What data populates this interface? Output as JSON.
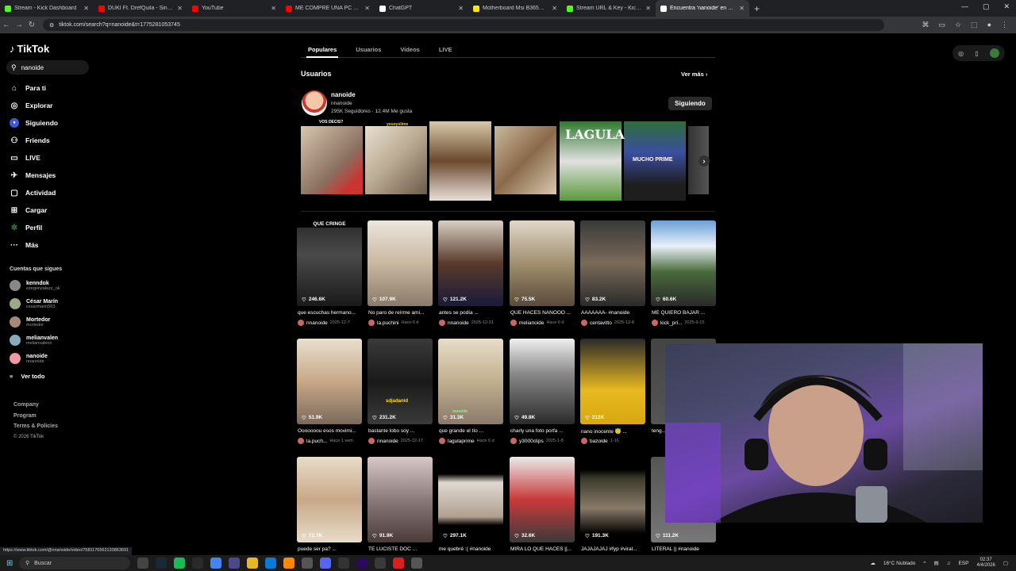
{
  "browser": {
    "tabs": [
      {
        "title": "Stream - Kick Dashboard",
        "color": "#53fc18"
      },
      {
        "title": "DUKI Ft. DrefQuila - Sin Culpa",
        "color": "#ff0000"
      },
      {
        "title": "YouTube",
        "color": "#ff0000"
      },
      {
        "title": "ME COMPRE UNA PC GAMER",
        "color": "#ff0000"
      },
      {
        "title": "ChatGPT",
        "color": "#ffffff"
      },
      {
        "title": "Motherboard Msi B365m Pro-V",
        "color": "#ffe600"
      },
      {
        "title": "Stream URL & Key - Kick Dashb",
        "color": "#53fc18"
      },
      {
        "title": "Encuentra 'nanoide' en TikTok",
        "color": "#ffffff"
      }
    ],
    "url": "tiktok.com/search?q=nanoide&t=1775281053745",
    "status_url": "https://www.tiktok.com/@nnanoide/video/7581176562133863691"
  },
  "sidebar": {
    "logo": "TikTok",
    "search_value": "nanoide",
    "nav": [
      {
        "label": "Para ti",
        "icon": "home-icon"
      },
      {
        "label": "Explorar",
        "icon": "compass-icon"
      },
      {
        "label": "Siguiendo",
        "icon": "following-icon"
      },
      {
        "label": "Friends",
        "icon": "friends-icon"
      },
      {
        "label": "LIVE",
        "icon": "live-icon"
      },
      {
        "label": "Mensajes",
        "icon": "messages-icon"
      },
      {
        "label": "Actividad",
        "icon": "activity-icon"
      },
      {
        "label": "Cargar",
        "icon": "upload-icon"
      },
      {
        "label": "Perfil",
        "icon": "profile-icon"
      },
      {
        "label": "Más",
        "icon": "more-icon"
      }
    ],
    "following_title": "Cuentas que sigues",
    "following": [
      {
        "name": "kenndok",
        "user": "ezegonzalezz_ok"
      },
      {
        "name": "César Marín",
        "user": "cesarmarin563"
      },
      {
        "name": "Mortedor",
        "user": "mortedor"
      },
      {
        "name": "melianvalen",
        "user": "melianvalenn"
      },
      {
        "name": "nanoide",
        "user": "nnanoide"
      }
    ],
    "see_all": "Ver todo",
    "footer": [
      "Company",
      "Program",
      "Terms & Policies"
    ],
    "copyright": "© 2026 TikTok"
  },
  "main": {
    "tabs": [
      "Populares",
      "Usuarios",
      "Videos",
      "LIVE"
    ],
    "users_section": "Usuarios",
    "see_more": "Ver más",
    "user": {
      "name": "nanoide",
      "handle": "nnanoide",
      "stats": "295K Seguidores  ·  12.4M Me gusta",
      "follow_label": "Siguiendo"
    },
    "strip_captions": [
      "VOS DECIS?",
      "yosoyslime"
    ],
    "strip_texts": [
      "LAGULA",
      "MUCHO PRIME"
    ],
    "videos": [
      {
        "likes": "246.6K",
        "caption": "que escuchas hermano...",
        "author": "nnanoide",
        "date": "2025-12-7",
        "overlay": "QUE CRINGE"
      },
      {
        "likes": "107.9K",
        "caption": "No paro de reírme ami...",
        "author": "la.puchini",
        "date": "Hace 6 d"
      },
      {
        "likes": "121.2K",
        "caption": "antes se podía ...",
        "author": "nnanoide",
        "date": "2025-12-31"
      },
      {
        "likes": "75.5K",
        "caption": "QUE HACES NANOOO ...",
        "author": "melianoide",
        "date": "Hace 6 d"
      },
      {
        "likes": "83.2K",
        "caption": "AAAAAAA- #nanoide",
        "author": "centavitto",
        "date": "2025-12-8"
      },
      {
        "likes": "60.6K",
        "caption": "ME QUIERO BAJAR ...",
        "author": "kick_pri...",
        "date": "2025-9-15"
      },
      {
        "likes": "51.9K",
        "caption": "Ooooooou esos movimi...",
        "author": "la.puch...",
        "date": "Hace 1 sem."
      },
      {
        "likes": "231.2K",
        "caption": "bastante lobo soy ...",
        "author": "nnanoide",
        "date": "2025-12-17"
      },
      {
        "likes": "31.3K",
        "caption": "que grande el tío ...",
        "author": "lagulaprime",
        "date": "Hace 6 d"
      },
      {
        "likes": "49.8K",
        "caption": "charly una foto porfa ...",
        "author": "y3000clips",
        "date": "2025-1-8"
      },
      {
        "likes": "212K",
        "caption": "nano inocente 😇 ...",
        "author": "bazoide",
        "date": "1-16"
      },
      {
        "likes": "",
        "caption": "teng...",
        "author": "",
        "date": ""
      },
      {
        "likes": "72.7K",
        "caption": "puede ser pa? ...",
        "author": "",
        "date": ""
      },
      {
        "likes": "91.9K",
        "caption": "TE LUCISTE DOC ...",
        "author": "",
        "date": ""
      },
      {
        "likes": "297.1K",
        "caption": "me quebré :( #nanoide",
        "author": "",
        "date": ""
      },
      {
        "likes": "32.6K",
        "caption": "MIRA LO QUE HACES ||...",
        "author": "",
        "date": ""
      },
      {
        "likes": "191.3K",
        "caption": "JAJAJAJAJ #fyp #viral...",
        "author": "",
        "date": ""
      },
      {
        "likes": "111.2K",
        "caption": "LITERAL || #nanoide",
        "author": "",
        "date": ""
      }
    ],
    "video_overlays": [
      "sdjadanid",
      "nanoide"
    ]
  },
  "taskbar": {
    "search_placeholder": "Buscar",
    "weather": "16°C  Nublado",
    "lang": "ESP",
    "time": "02:37",
    "date": "4/4/2026"
  }
}
